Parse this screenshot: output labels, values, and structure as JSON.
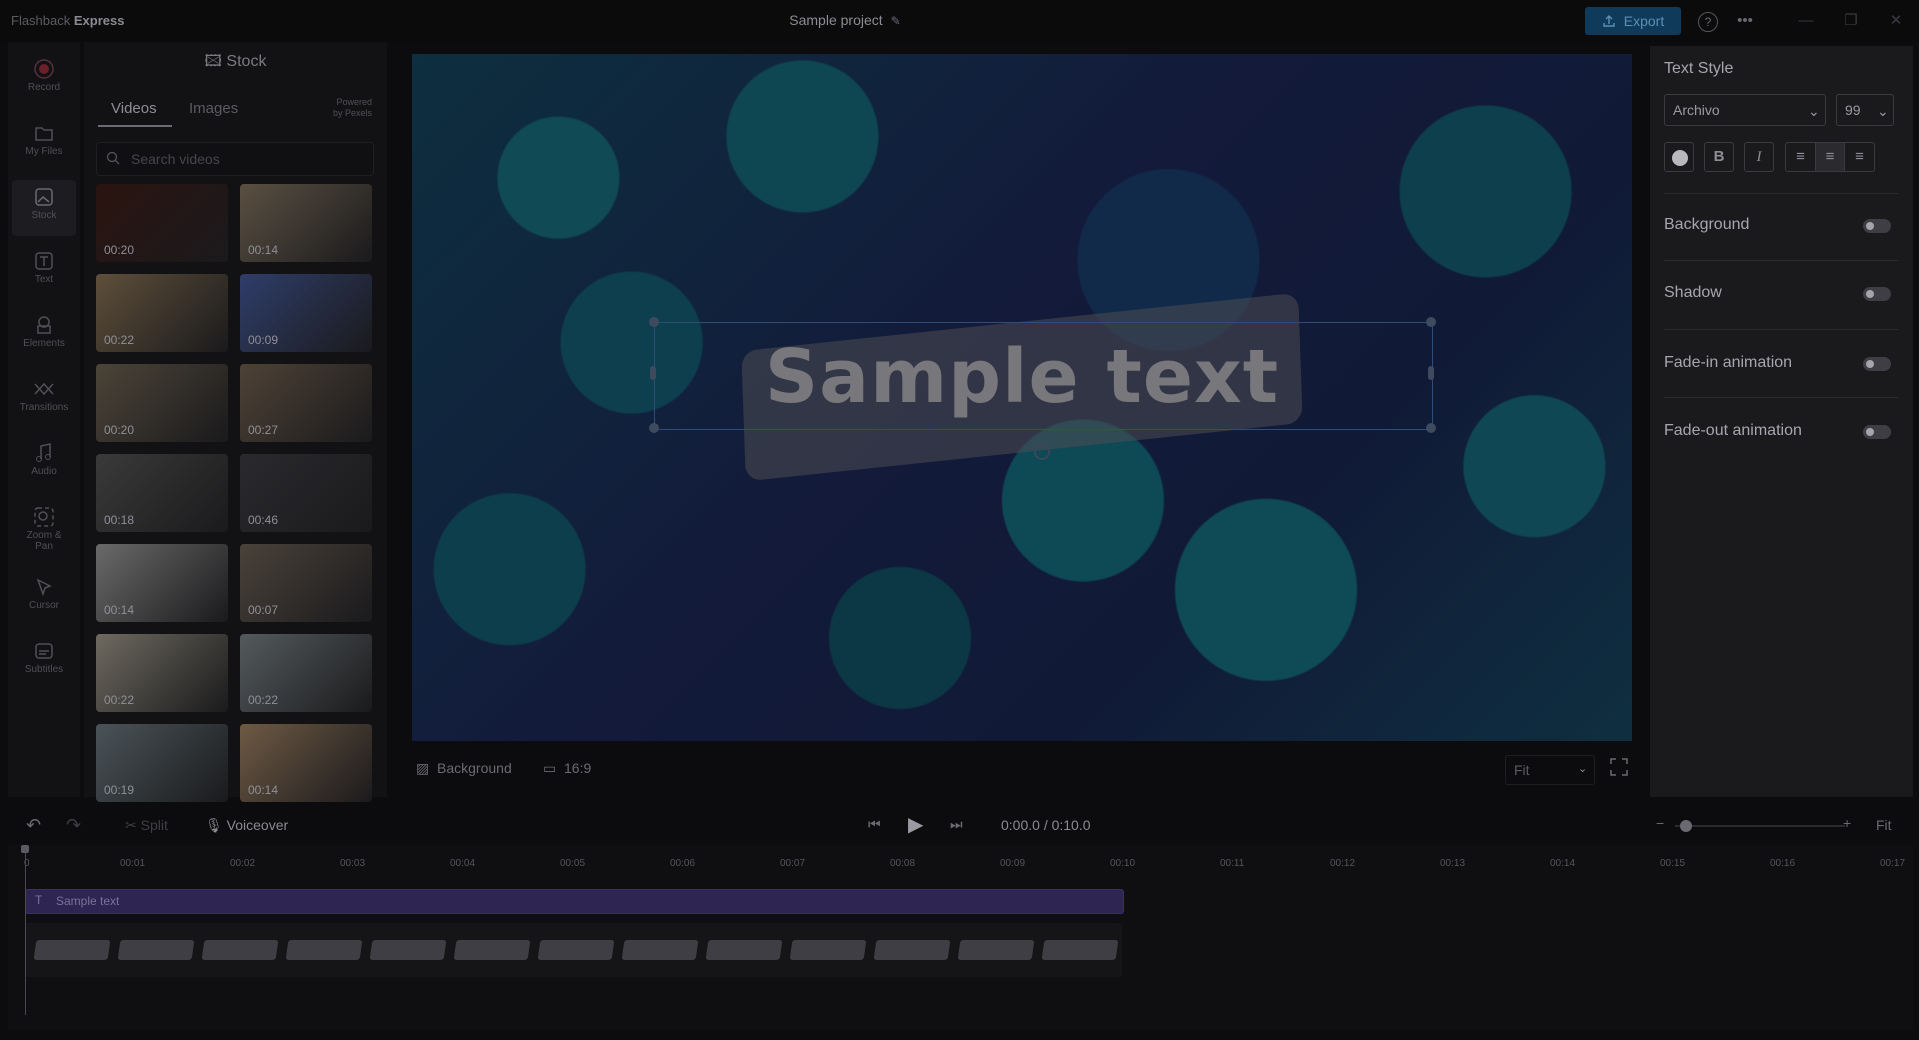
{
  "app": {
    "brand_light": "Flashback",
    "brand_bold": "Express",
    "project_title": "Sample project",
    "export_label": "Export"
  },
  "nav": {
    "items": [
      {
        "label": "Record",
        "icon": "record-icon"
      },
      {
        "label": "My Files",
        "icon": "folder-icon"
      },
      {
        "label": "Stock",
        "icon": "image-icon"
      },
      {
        "label": "Text",
        "icon": "text-icon"
      },
      {
        "label": "Elements",
        "icon": "shapes-icon"
      },
      {
        "label": "Transitions",
        "icon": "transitions-icon"
      },
      {
        "label": "Audio",
        "icon": "music-icon"
      },
      {
        "label": "Zoom &",
        "label2": "Pan",
        "icon": "zoom-icon"
      },
      {
        "label": "Cursor",
        "icon": "cursor-icon"
      },
      {
        "label": "Subtitles",
        "icon": "subtitles-icon"
      }
    ]
  },
  "stock": {
    "title": "Stock",
    "tabs": {
      "videos": "Videos",
      "images": "Images"
    },
    "powered": "Powered",
    "powered2": "by Pexels",
    "search_placeholder": "Search videos",
    "thumbs": [
      {
        "dur": "00:20",
        "color": "#2a1410"
      },
      {
        "dur": "00:14",
        "color": "#5a5042"
      },
      {
        "dur": "00:22",
        "color": "#5e4f3a"
      },
      {
        "dur": "00:09",
        "color": "#2f3d6a"
      },
      {
        "dur": "00:20",
        "color": "#4c4438"
      },
      {
        "dur": "00:27",
        "color": "#4e4236"
      },
      {
        "dur": "00:18",
        "color": "#3a3a3a"
      },
      {
        "dur": "00:46",
        "color": "#2a2a2e"
      },
      {
        "dur": "00:14",
        "color": "#6a6a6a"
      },
      {
        "dur": "00:07",
        "color": "#4a423a"
      },
      {
        "dur": "00:22",
        "color": "#6e6a60"
      },
      {
        "dur": "00:22",
        "color": "#545a5c"
      },
      {
        "dur": "00:19",
        "color": "#4a5458"
      },
      {
        "dur": "00:14",
        "color": "#6e5a44"
      }
    ]
  },
  "canvas": {
    "sample_text": "Sample text",
    "background_label": "Background",
    "ratio_label": "16:9",
    "fit_label": "Fit"
  },
  "text_style": {
    "title": "Text Style",
    "font": "Archivo",
    "size": "99",
    "bold": "B",
    "italic": "I",
    "rows": [
      {
        "label": "Background",
        "on": false
      },
      {
        "label": "Shadow",
        "on": false
      },
      {
        "label": "Fade-in animation",
        "on": false
      },
      {
        "label": "Fade-out animation",
        "on": false
      }
    ]
  },
  "playback": {
    "split": "Split",
    "voiceover": "Voiceover",
    "time": "0:00.0 / 0:10.0",
    "fit": "Fit"
  },
  "timeline": {
    "ticks": [
      "0",
      "00:01",
      "00:02",
      "00:03",
      "00:04",
      "00:05",
      "00:06",
      "00:07",
      "00:08",
      "00:09",
      "00:10",
      "00:11",
      "00:12",
      "00:13",
      "00:14",
      "00:15",
      "00:16",
      "00:17"
    ],
    "text_clip": "Sample text"
  }
}
